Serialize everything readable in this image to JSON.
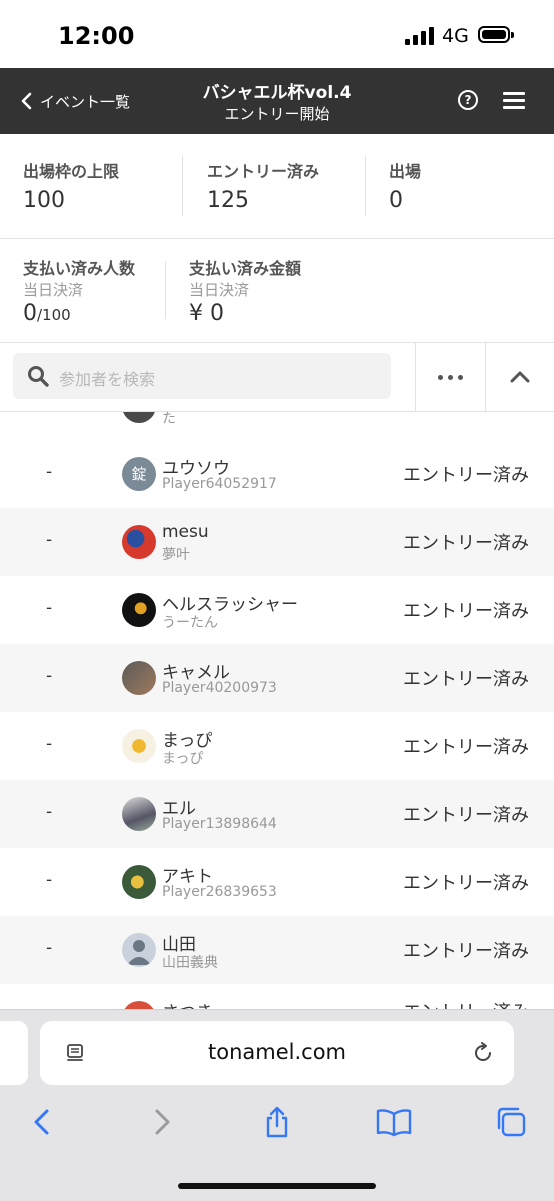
{
  "status_bar": {
    "time": "12:00",
    "network": "4G"
  },
  "nav": {
    "back_label": "イベント一覧",
    "title": "バシャエル杯vol.4",
    "subtitle": "エントリー開始"
  },
  "stats": {
    "cap_label": "出場枠の上限",
    "cap_value": "100",
    "entered_label": "エントリー済み",
    "entered_value": "125",
    "playing_label": "出場",
    "playing_value": "0"
  },
  "payments": {
    "count_label": "支払い済み人数",
    "count_sub": "当日決済",
    "count_value": "0",
    "count_total": "/100",
    "amount_label": "支払い済み金額",
    "amount_sub": "当日決済",
    "amount_value": "¥ 0"
  },
  "search": {
    "placeholder": "参加者を検索"
  },
  "participants": [
    {
      "rank": "",
      "name": "",
      "sub": "た",
      "status": "",
      "avatar_color": "#4a4a4a"
    },
    {
      "rank": "-",
      "name": "ユウソウ",
      "sub": "Player64052917",
      "status": "エントリー済み",
      "avatar_color": "#7a8a96",
      "avatar_char": "錠"
    },
    {
      "rank": "-",
      "name": "mesu",
      "sub": "夢叶",
      "status": "エントリー済み",
      "avatar_color": "#c8322c"
    },
    {
      "rank": "-",
      "name": "ヘルスラッシャー",
      "sub": "うーたん",
      "status": "エントリー済み",
      "avatar_color": "#1a1a1a"
    },
    {
      "rank": "-",
      "name": "キャメル",
      "sub": "Player40200973",
      "status": "エントリー済み",
      "avatar_color": "#8a6a55"
    },
    {
      "rank": "-",
      "name": "まっぴ",
      "sub": "まっぴ",
      "status": "エントリー済み",
      "avatar_color": "#f4e8c8"
    },
    {
      "rank": "-",
      "name": "エル",
      "sub": "Player13898644",
      "status": "エントリー済み",
      "avatar_color": "#6f7a6a"
    },
    {
      "rank": "-",
      "name": "アキト",
      "sub": "Player26839653",
      "status": "エントリー済み",
      "avatar_color": "#b08a3a"
    },
    {
      "rank": "-",
      "name": "山田",
      "sub": "山田義典",
      "status": "エントリー済み",
      "avatar_color": "#c9d2dc"
    },
    {
      "rank": "",
      "name": "さつき",
      "sub": "",
      "status": "エントリー済み",
      "avatar_color": "#d8503c"
    }
  ],
  "browser": {
    "domain": "tonamel.com"
  }
}
